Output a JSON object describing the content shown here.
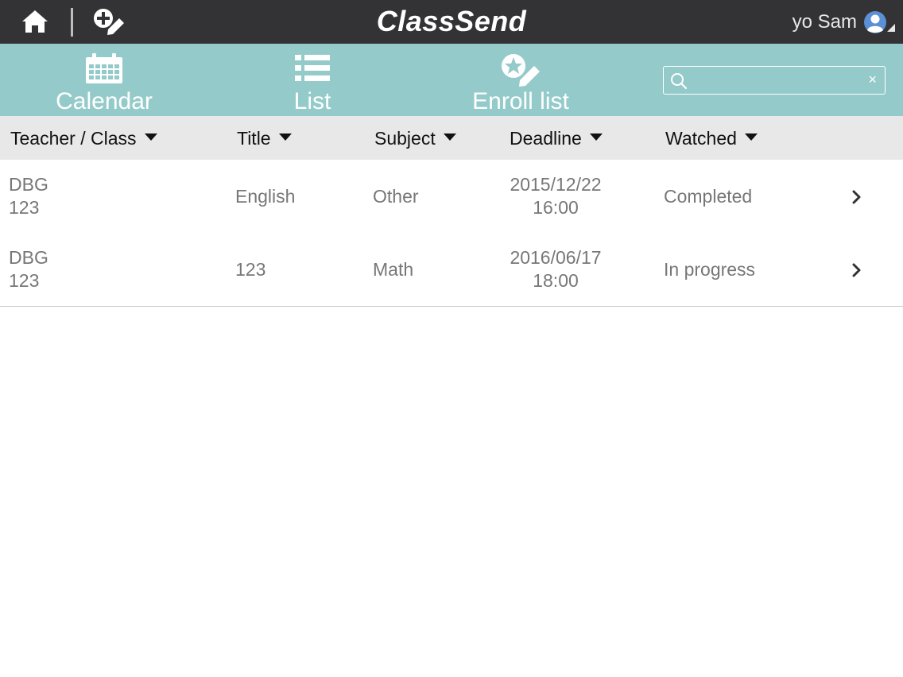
{
  "topbar": {
    "title": "ClassSend",
    "user_name": "yo Sam"
  },
  "nav": {
    "items": [
      {
        "label": "Calendar",
        "icon": "calendar-icon"
      },
      {
        "label": "List",
        "icon": "list-icon"
      },
      {
        "label": "Enroll list",
        "icon": "enroll-icon"
      }
    ],
    "search": {
      "value": "",
      "placeholder": "",
      "clear_label": "×"
    }
  },
  "table": {
    "columns": [
      "Teacher / Class",
      "Title",
      "Subject",
      "Deadline",
      "Watched"
    ],
    "rows": [
      {
        "teacher": "DBG",
        "class": "123",
        "title": "English",
        "subject": "Other",
        "deadline_date": "2015/12/22",
        "deadline_time": "16:00",
        "watched": "Completed"
      },
      {
        "teacher": "DBG",
        "class": "123",
        "title": "123",
        "subject": "Math",
        "deadline_date": "2016/06/17",
        "deadline_time": "18:00",
        "watched": "In progress"
      }
    ]
  },
  "colors": {
    "topbar_bg": "#333235",
    "nav_bg": "#94cbca",
    "header_bg": "#e8e8e8",
    "avatar": "#5b8fd6"
  }
}
